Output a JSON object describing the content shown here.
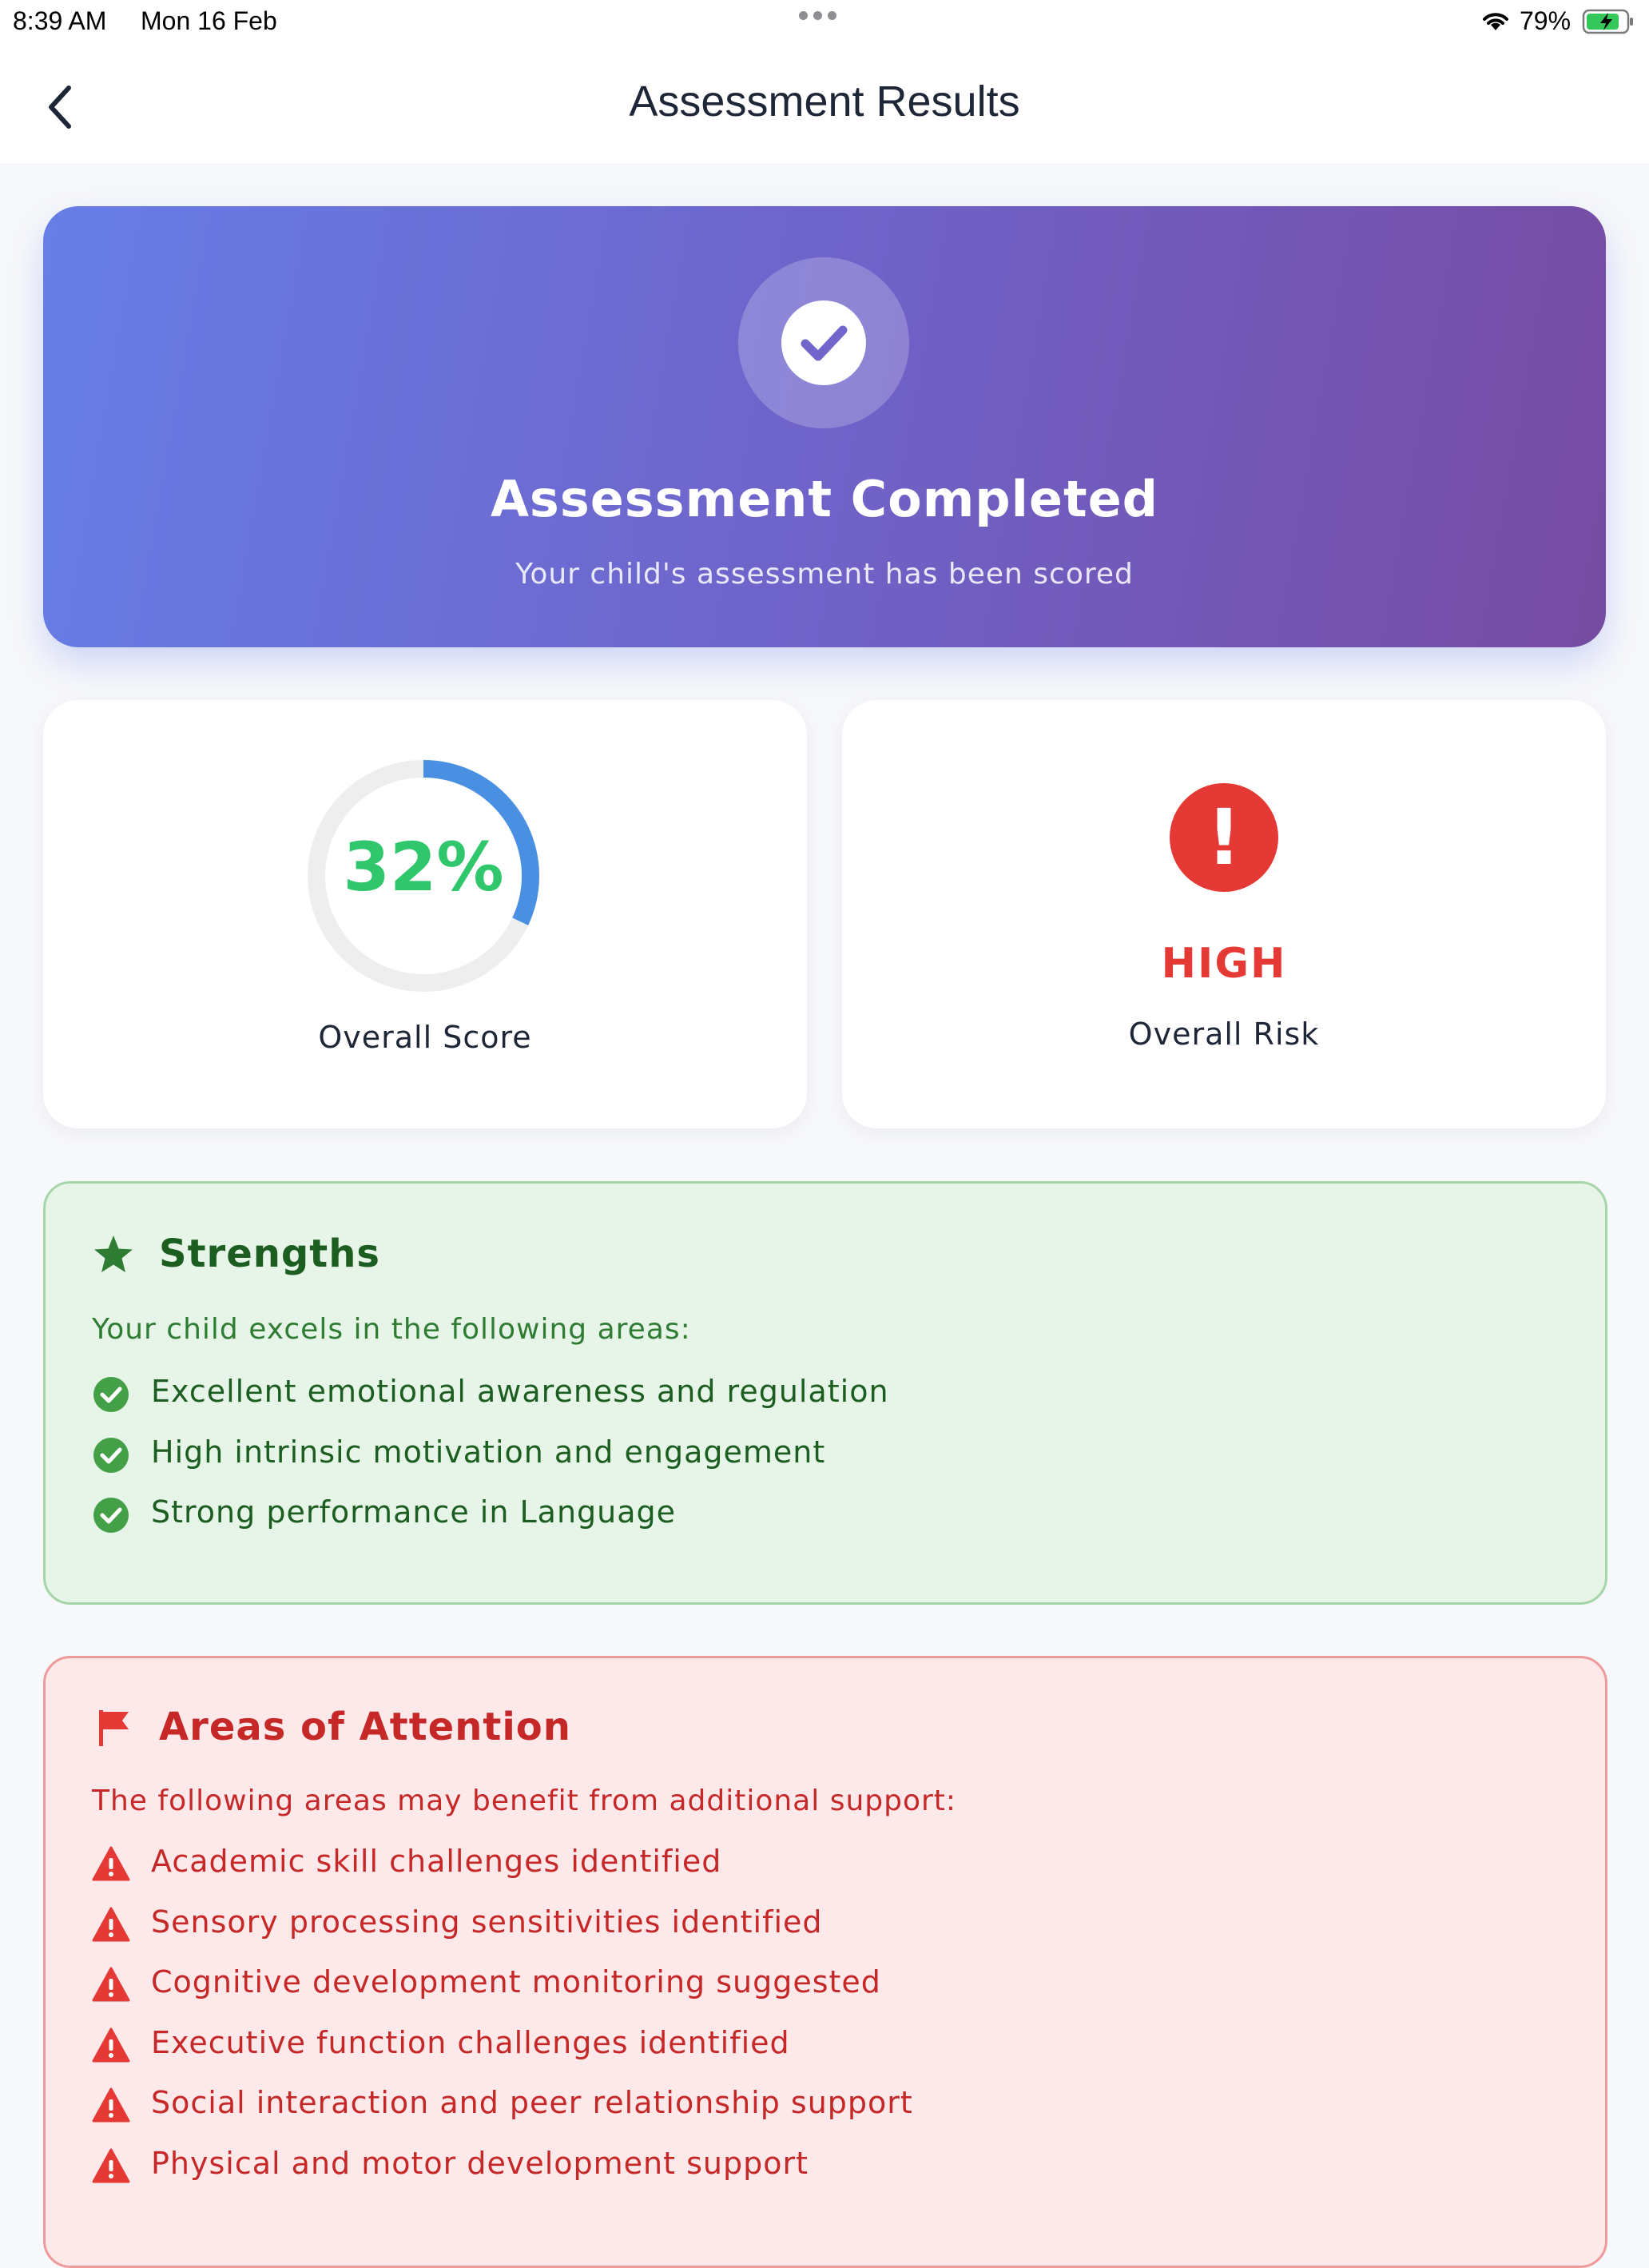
{
  "status_bar": {
    "time": "8:39 AM",
    "date": "Mon 16 Feb",
    "battery": "79%",
    "icons": [
      "multitask-dots-icon",
      "wifi-icon",
      "battery-charging-icon"
    ]
  },
  "nav": {
    "title": "Assessment Results",
    "back_icon": "chevron-left-icon"
  },
  "hero": {
    "icon": "check-circle-icon",
    "title": "Assessment Completed",
    "subtitle": "Your child's assessment has been scored",
    "gradient_colors": [
      "#667ee6",
      "#764ba2"
    ]
  },
  "score_card": {
    "value": "32%",
    "progress": 0.32,
    "label": "Overall Score",
    "value_color": "#2fc66c",
    "ring_color": "#4a90e2"
  },
  "risk_card": {
    "icon": "exclamation-circle-icon",
    "level": "HIGH",
    "label": "Overall Risk",
    "color": "#e53935"
  },
  "strengths": {
    "icon": "star-icon",
    "title": "Strengths",
    "description": "Your child excels in the following areas:",
    "item_icon": "check-circle-icon",
    "items": [
      "Excellent emotional awareness and regulation",
      "High intrinsic motivation and engagement",
      "Strong performance in Language"
    ]
  },
  "attention": {
    "icon": "flag-icon",
    "title": "Areas of Attention",
    "description": "The following areas may benefit from additional support:",
    "item_icon": "warning-triangle-icon",
    "items": [
      "Academic skill challenges identified",
      "Sensory processing sensitivities identified",
      "Cognitive development monitoring suggested",
      "Executive function challenges identified",
      "Social interaction and peer relationship support",
      "Physical and motor development support"
    ]
  }
}
